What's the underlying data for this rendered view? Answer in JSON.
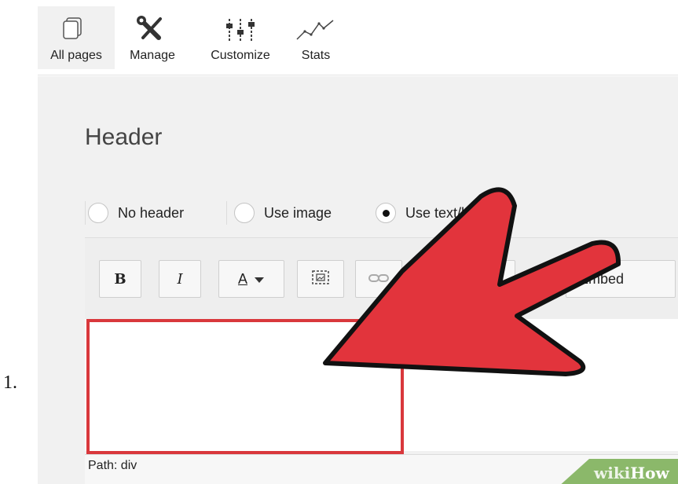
{
  "step": {
    "number": "1."
  },
  "toolbar": {
    "items": [
      {
        "label": "All pages",
        "icon": "pages-icon",
        "active": true
      },
      {
        "label": "Manage",
        "icon": "wrench-screwdriver-icon"
      },
      {
        "label": "Customize",
        "icon": "sliders-icon"
      },
      {
        "label": "Stats",
        "icon": "line-chart-icon"
      }
    ]
  },
  "section": {
    "title": "Header"
  },
  "header_options": {
    "no_header": "No header",
    "use_image": "Use image",
    "use_text": "Use text/h",
    "selected": "Use text/h"
  },
  "editor_toolbar": {
    "bold": "B",
    "italic": "I",
    "text_color": "A",
    "embed": "Embed"
  },
  "editor": {
    "path": "Path: div"
  },
  "watermark": {
    "part1": "wiki",
    "part2": "How"
  },
  "colors": {
    "highlight_red": "#d9383c",
    "arrow_red": "#e2343c",
    "wikihow_green": "#8bb86a"
  }
}
